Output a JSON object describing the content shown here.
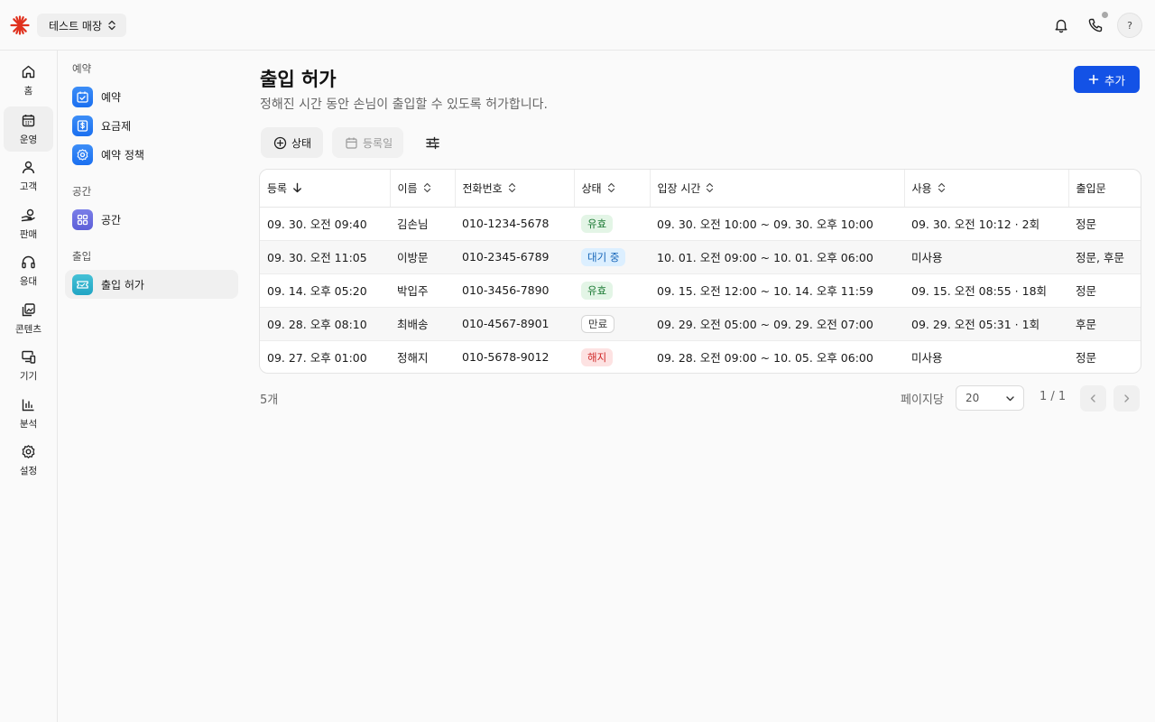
{
  "header": {
    "store_name": "테스트 매장",
    "help_label": "?"
  },
  "rail": [
    {
      "label": "홈",
      "icon": "home-icon"
    },
    {
      "label": "운영",
      "icon": "calendar-icon",
      "active": true
    },
    {
      "label": "고객",
      "icon": "user-icon"
    },
    {
      "label": "판매",
      "icon": "sales-icon"
    },
    {
      "label": "응대",
      "icon": "headset-icon"
    },
    {
      "label": "콘텐츠",
      "icon": "content-icon"
    },
    {
      "label": "기기",
      "icon": "devices-icon"
    },
    {
      "label": "분석",
      "icon": "chart-icon"
    },
    {
      "label": "설정",
      "icon": "gear-icon"
    }
  ],
  "subnav": {
    "sections": [
      {
        "title": "예약",
        "items": [
          {
            "label": "예약",
            "icon": "calendar-check-icon"
          },
          {
            "label": "요금제",
            "icon": "pricing-icon"
          },
          {
            "label": "예약 정책",
            "icon": "policy-gear-icon"
          }
        ]
      },
      {
        "title": "공간",
        "items": [
          {
            "label": "공간",
            "icon": "grid-icon"
          }
        ]
      },
      {
        "title": "출입",
        "items": [
          {
            "label": "출입 허가",
            "icon": "ticket-icon",
            "active": true
          }
        ]
      }
    ]
  },
  "main": {
    "title": "출입 허가",
    "subtitle": "정해진 시간 동안 손님이 출입할 수 있도록 허가합니다.",
    "add_label": "추가",
    "filters": {
      "status": "상태",
      "date": "등록일"
    },
    "table": {
      "columns": [
        "등록",
        "이름",
        "전화번호",
        "상태",
        "입장 시간",
        "사용",
        "출입문"
      ],
      "rows": [
        {
          "registered": "09. 30. 오전 09:40",
          "name": "김손님",
          "phone": "010-1234-5678",
          "status": "유효",
          "status_type": "valid",
          "entry": "09. 30. 오전 10:00 ~ 09. 30. 오후 10:00",
          "usage": "09. 30. 오전 10:12 · 2회",
          "door": "정문"
        },
        {
          "registered": "09. 30. 오전 11:05",
          "name": "이방문",
          "phone": "010-2345-6789",
          "status": "대기 중",
          "status_type": "wait",
          "entry": "10. 01. 오전 09:00 ~ 10. 01. 오후 06:00",
          "usage": "미사용",
          "door": "정문, 후문"
        },
        {
          "registered": "09. 14. 오후 05:20",
          "name": "박입주",
          "phone": "010-3456-7890",
          "status": "유효",
          "status_type": "valid",
          "entry": "09. 15. 오전 12:00 ~ 10. 14. 오후 11:59",
          "usage": "09. 15. 오전 08:55 · 18회",
          "door": "정문"
        },
        {
          "registered": "09. 28. 오후 08:10",
          "name": "최배송",
          "phone": "010-4567-8901",
          "status": "만료",
          "status_type": "expired",
          "entry": "09. 29. 오전 05:00 ~ 09. 29. 오전 07:00",
          "usage": "09. 29. 오전 05:31 · 1회",
          "door": "후문"
        },
        {
          "registered": "09. 27. 오후 01:00",
          "name": "정해지",
          "phone": "010-5678-9012",
          "status": "해지",
          "status_type": "cancel",
          "entry": "09. 28. 오전 09:00 ~ 10. 05. 오후 06:00",
          "usage": "미사용",
          "door": "정문"
        }
      ]
    },
    "footer": {
      "count": "5개",
      "per_page_label": "페이지당",
      "per_page_value": "20",
      "page_info": "1 / 1"
    }
  },
  "colors": {
    "accent": "#1352e6",
    "valid": "#1d7a35",
    "wait": "#1464b8",
    "cancel": "#d02a2a"
  }
}
